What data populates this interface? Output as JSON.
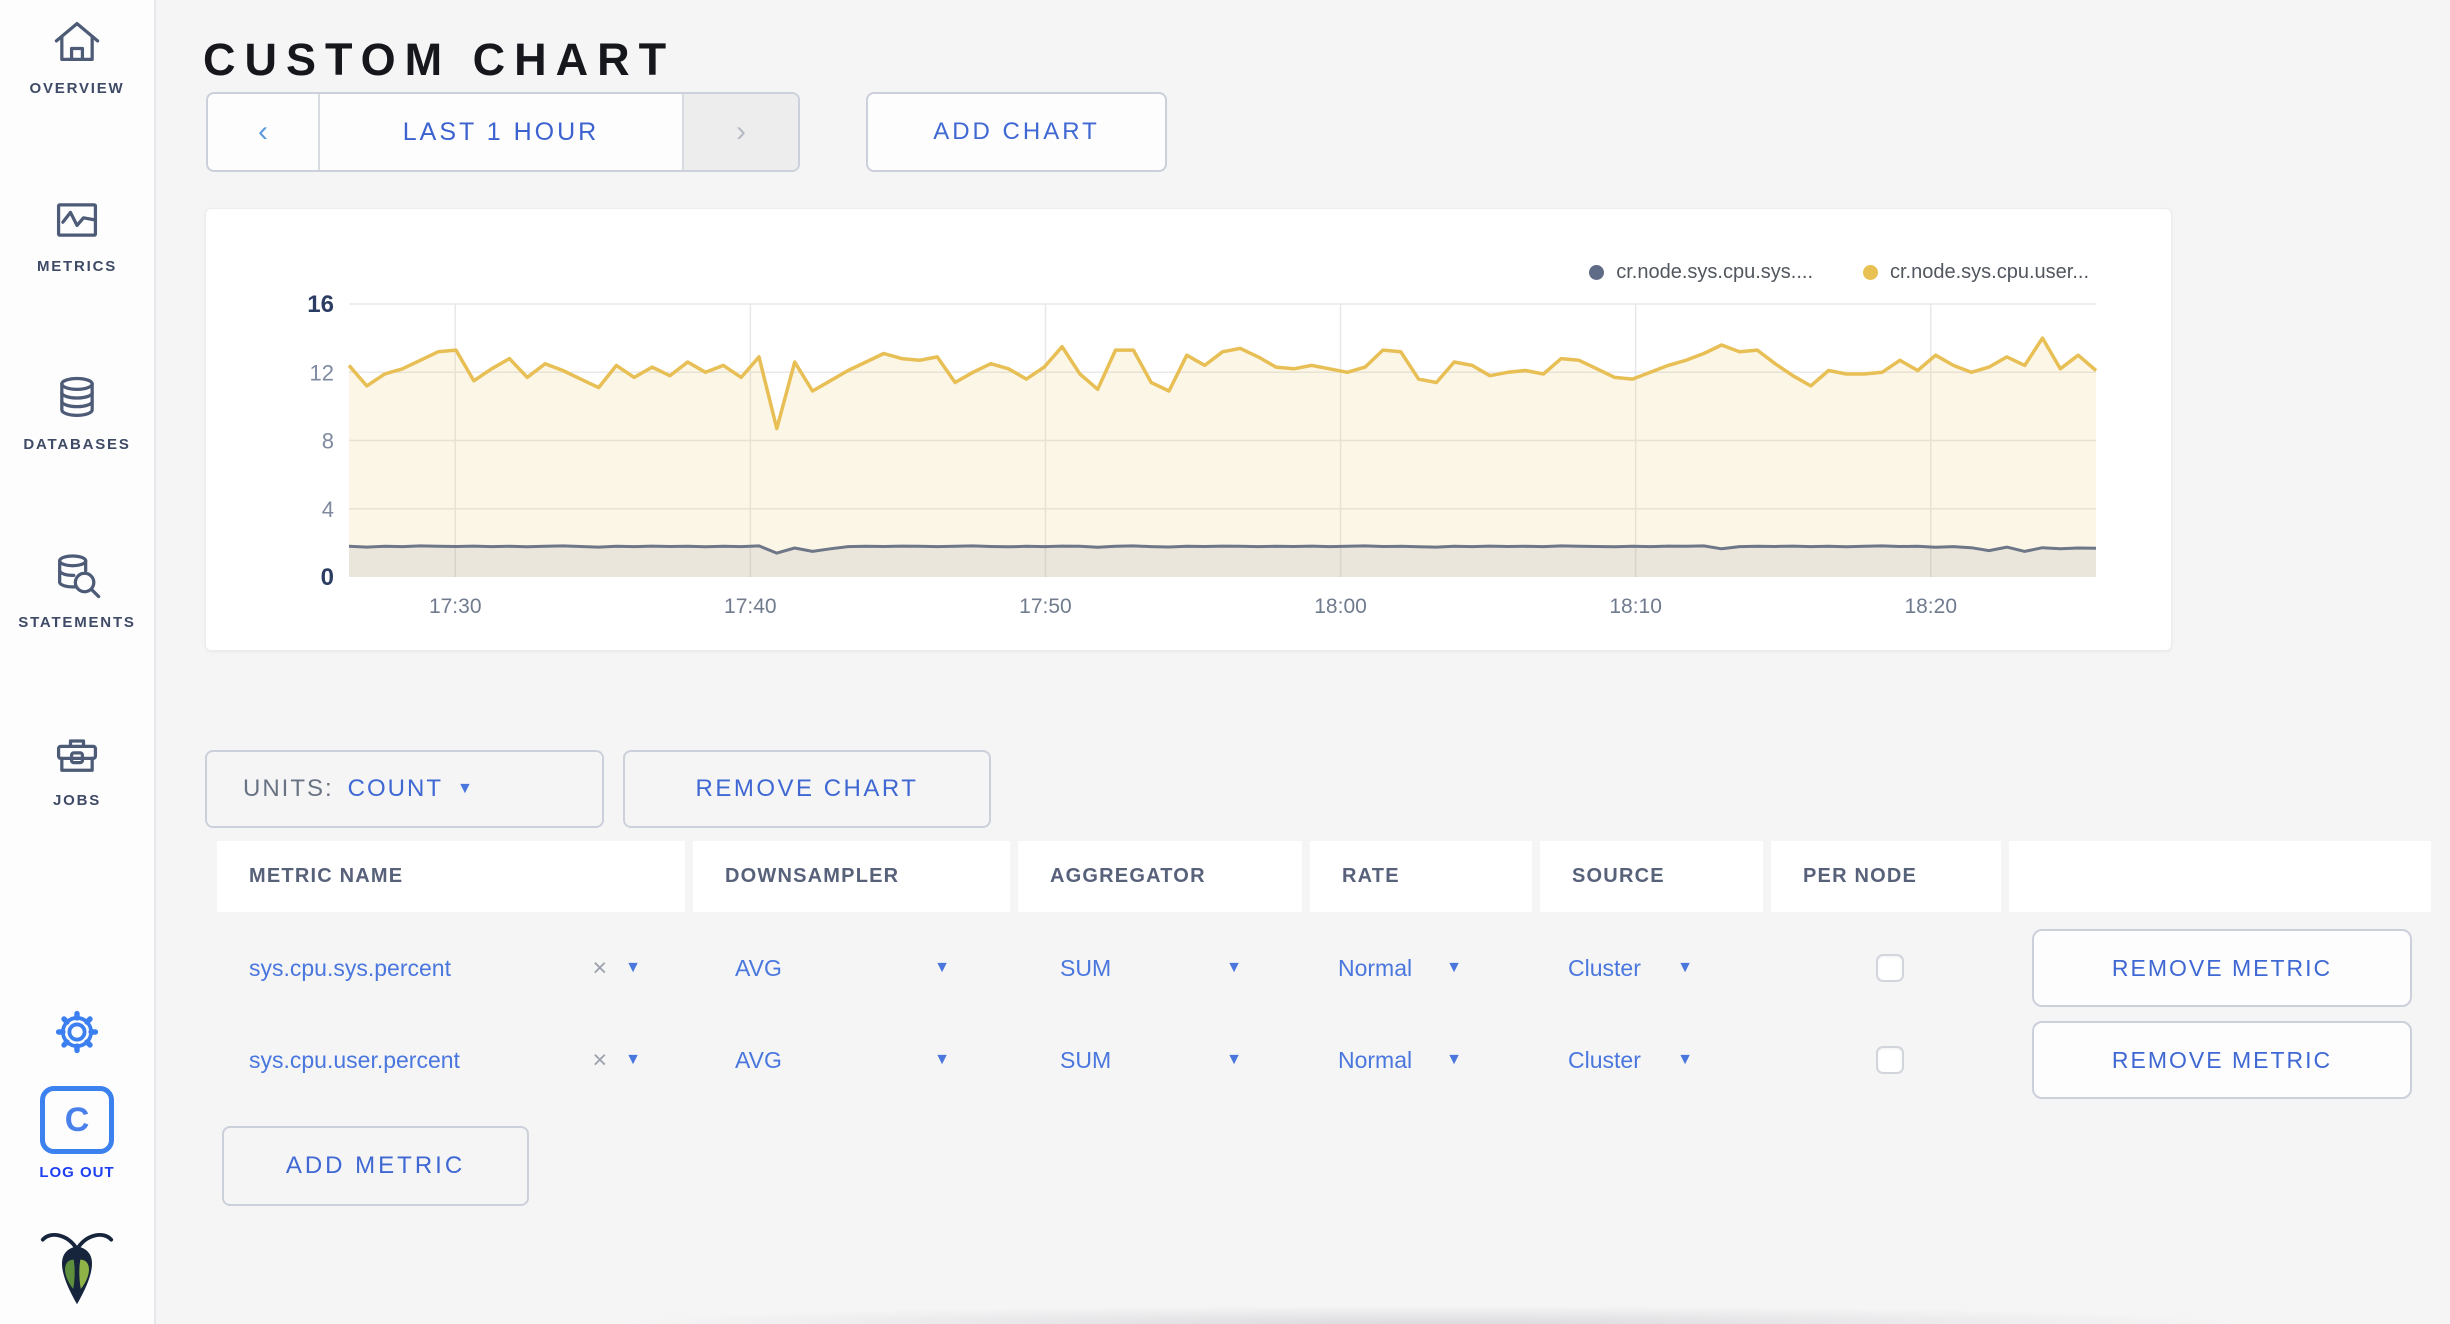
{
  "sidebar": {
    "items": [
      {
        "label": "OVERVIEW",
        "icon": "home-icon"
      },
      {
        "label": "METRICS",
        "icon": "graph-icon"
      },
      {
        "label": "DATABASES",
        "icon": "database-icon"
      },
      {
        "label": "STATEMENTS",
        "icon": "database-search-icon"
      },
      {
        "label": "JOBS",
        "icon": "briefcase-icon"
      }
    ],
    "logout": {
      "label": "LOG OUT",
      "icon_letter": "C"
    }
  },
  "header": {
    "title": "CUSTOM CHART"
  },
  "timepicker": {
    "prev": "‹",
    "range_label": "LAST 1 HOUR",
    "next": "›"
  },
  "buttons": {
    "add_chart": "ADD CHART",
    "remove_chart": "REMOVE CHART",
    "add_metric": "ADD METRIC"
  },
  "units": {
    "label": "UNITS:",
    "value": "COUNT"
  },
  "chart_data": {
    "type": "line",
    "title": "",
    "xlabel": "",
    "ylabel": "",
    "ylim": [
      0,
      16
    ],
    "y_ticks": [
      0,
      4,
      8,
      12,
      16
    ],
    "x_ticks": [
      "17:30",
      "17:40",
      "17:50",
      "18:00",
      "18:10",
      "18:20"
    ],
    "grid": true,
    "legend_position": "top-right",
    "series": [
      {
        "name": "cr.node.sys.cpu.sys....",
        "legend_color": "#5f6c87",
        "color": "#6e7787",
        "fill": "rgba(107,116,134,0.12)",
        "values": [
          1.8,
          1.75,
          1.8,
          1.78,
          1.82,
          1.8,
          1.79,
          1.81,
          1.78,
          1.8,
          1.77,
          1.8,
          1.82,
          1.79,
          1.75,
          1.8,
          1.78,
          1.81,
          1.79,
          1.8,
          1.77,
          1.8,
          1.78,
          1.82,
          1.4,
          1.7,
          1.5,
          1.65,
          1.78,
          1.8,
          1.79,
          1.81,
          1.8,
          1.78,
          1.8,
          1.82,
          1.79,
          1.77,
          1.8,
          1.78,
          1.81,
          1.8,
          1.74,
          1.8,
          1.82,
          1.78,
          1.76,
          1.8,
          1.79,
          1.81,
          1.8,
          1.78,
          1.8,
          1.79,
          1.81,
          1.78,
          1.8,
          1.82,
          1.79,
          1.8,
          1.77,
          1.75,
          1.8,
          1.78,
          1.81,
          1.79,
          1.8,
          1.78,
          1.82,
          1.8,
          1.79,
          1.77,
          1.8,
          1.78,
          1.81,
          1.8,
          1.82,
          1.65,
          1.78,
          1.8,
          1.79,
          1.81,
          1.78,
          1.8,
          1.77,
          1.8,
          1.82,
          1.79,
          1.8,
          1.74,
          1.78,
          1.72,
          1.55,
          1.75,
          1.5,
          1.72,
          1.65,
          1.7,
          1.68
        ]
      },
      {
        "name": "cr.node.sys.cpu.user...",
        "legend_color": "#e9c153",
        "color": "#e7bf55",
        "fill": "rgba(233,194,88,0.14)",
        "values": [
          12.4,
          11.2,
          11.9,
          12.2,
          12.7,
          13.2,
          13.3,
          11.5,
          12.2,
          12.8,
          11.7,
          12.5,
          12.1,
          11.6,
          11.1,
          12.4,
          11.7,
          12.3,
          11.8,
          12.6,
          12.0,
          12.4,
          11.7,
          12.9,
          8.7,
          12.6,
          10.9,
          11.5,
          12.1,
          12.6,
          13.1,
          12.8,
          12.7,
          12.9,
          11.4,
          12.0,
          12.5,
          12.2,
          11.6,
          12.3,
          13.5,
          11.9,
          11.0,
          13.3,
          13.3,
          11.4,
          10.9,
          13.0,
          12.4,
          13.2,
          13.4,
          12.9,
          12.3,
          12.2,
          12.4,
          12.2,
          12.0,
          12.3,
          13.3,
          13.2,
          11.6,
          11.4,
          12.6,
          12.4,
          11.8,
          12.0,
          12.1,
          11.9,
          12.8,
          12.7,
          12.2,
          11.7,
          11.6,
          12.0,
          12.4,
          12.7,
          13.1,
          13.6,
          13.2,
          13.3,
          12.5,
          11.8,
          11.2,
          12.1,
          11.9,
          11.9,
          12.0,
          12.7,
          12.1,
          13.0,
          12.4,
          12.0,
          12.3,
          12.9,
          12.4,
          14.0,
          12.2,
          13.0,
          12.1
        ]
      }
    ]
  },
  "metrics_table": {
    "columns": [
      "METRIC NAME",
      "DOWNSAMPLER",
      "AGGREGATOR",
      "RATE",
      "SOURCE",
      "PER NODE",
      ""
    ],
    "rows": [
      {
        "metric_name": "sys.cpu.sys.percent",
        "clear_icon": "×",
        "downsampler": "AVG",
        "aggregator": "SUM",
        "rate": "Normal",
        "source": "Cluster",
        "per_node_checked": false,
        "remove_label": "REMOVE METRIC"
      },
      {
        "metric_name": "sys.cpu.user.percent",
        "clear_icon": "×",
        "downsampler": "AVG",
        "aggregator": "SUM",
        "rate": "Normal",
        "source": "Cluster",
        "per_node_checked": false,
        "remove_label": "REMOVE METRIC"
      }
    ]
  }
}
